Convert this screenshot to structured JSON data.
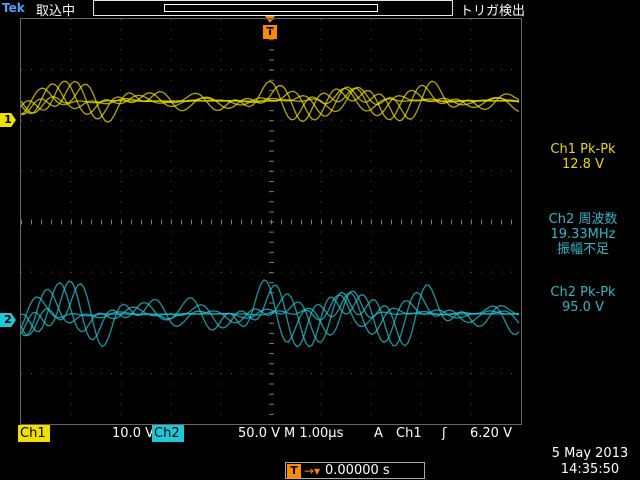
{
  "header": {
    "brand": "Tek",
    "acq_status": "取込中",
    "trig_status": "トリガ検出"
  },
  "channels": {
    "ch1": {
      "label": "Ch1",
      "marker": "1",
      "color": "#f0e000",
      "scale": "10.0 V"
    },
    "ch2": {
      "label": "Ch2",
      "marker": "2",
      "color": "#1ec8d8",
      "scale": "50.0 V"
    }
  },
  "timebase": {
    "label": "M 1.00µs"
  },
  "trigger": {
    "mode": "A",
    "source": "Ch1",
    "edge_symbol": "ʃ",
    "level": "6.20 V",
    "position": "0.00000 s",
    "marker": "T",
    "arrow": "→▾"
  },
  "measurements": [
    {
      "title": "Ch1 Pk-Pk",
      "value": "12.8 V",
      "note": ""
    },
    {
      "title": "Ch2 周波数",
      "value": "19.33MHz",
      "note": "振幅不足"
    },
    {
      "title": "Ch2 Pk-Pk",
      "value": "95.0 V",
      "note": ""
    }
  ],
  "datetime": {
    "date": "5 May 2013",
    "time": "14:35:50"
  }
}
